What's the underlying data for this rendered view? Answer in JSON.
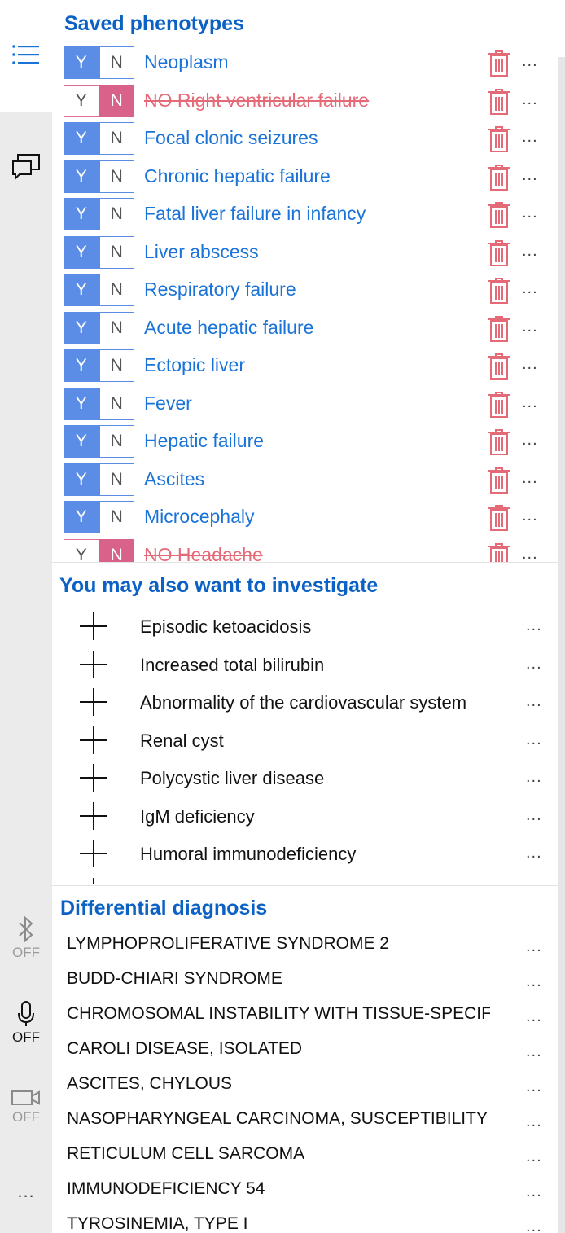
{
  "rail": {
    "bluetooth": {
      "icon": "bluetooth-icon",
      "status": "OFF"
    },
    "microphone": {
      "icon": "microphone-icon",
      "status": "OFF"
    },
    "camera": {
      "icon": "camera-icon",
      "status": "OFF"
    },
    "more": "..."
  },
  "saved": {
    "title": "Saved phenotypes",
    "yes_label": "Y",
    "no_label": "N",
    "items": [
      {
        "name": "Neoplasm",
        "negated": false
      },
      {
        "name": "NO Right ventricular failure",
        "negated": true
      },
      {
        "name": "Focal clonic seizures",
        "negated": false
      },
      {
        "name": "Chronic hepatic failure",
        "negated": false
      },
      {
        "name": "Fatal liver failure in infancy",
        "negated": false
      },
      {
        "name": "Liver abscess",
        "negated": false
      },
      {
        "name": "Respiratory failure",
        "negated": false
      },
      {
        "name": "Acute hepatic failure",
        "negated": false
      },
      {
        "name": "Ectopic liver",
        "negated": false
      },
      {
        "name": "Fever",
        "negated": false
      },
      {
        "name": "Hepatic failure",
        "negated": false
      },
      {
        "name": "Ascites",
        "negated": false
      },
      {
        "name": "Microcephaly",
        "negated": false
      },
      {
        "name": "NO Headache",
        "negated": true
      }
    ]
  },
  "suggestions": {
    "title": "You may also want to investigate",
    "items": [
      "Episodic ketoacidosis",
      "Increased total bilirubin",
      "Abnormality of the cardiovascular system",
      "Renal cyst",
      "Polycystic liver disease",
      "IgM deficiency",
      "Humoral immunodeficiency",
      ""
    ]
  },
  "differential": {
    "title": "Differential diagnosis",
    "items": [
      "LYMPHOPROLIFERATIVE SYNDROME 2",
      "BUDD-CHIARI SYNDROME",
      "CHROMOSOMAL INSTABILITY WITH TISSUE-SPECIFIC",
      "CAROLI DISEASE, ISOLATED",
      "ASCITES, CHYLOUS",
      "NASOPHARYNGEAL CARCINOMA, SUSCEPTIBILITY",
      "RETICULUM CELL SARCOMA",
      "IMMUNODEFICIENCY 54",
      "TYROSINEMIA, TYPE I"
    ]
  },
  "more_label": "...",
  "colors": {
    "accent": "#0b61c4",
    "link": "#1a73d9",
    "yes_fill": "#5b8de6",
    "no_fill": "#d9628a",
    "trash": "#e46a78"
  }
}
